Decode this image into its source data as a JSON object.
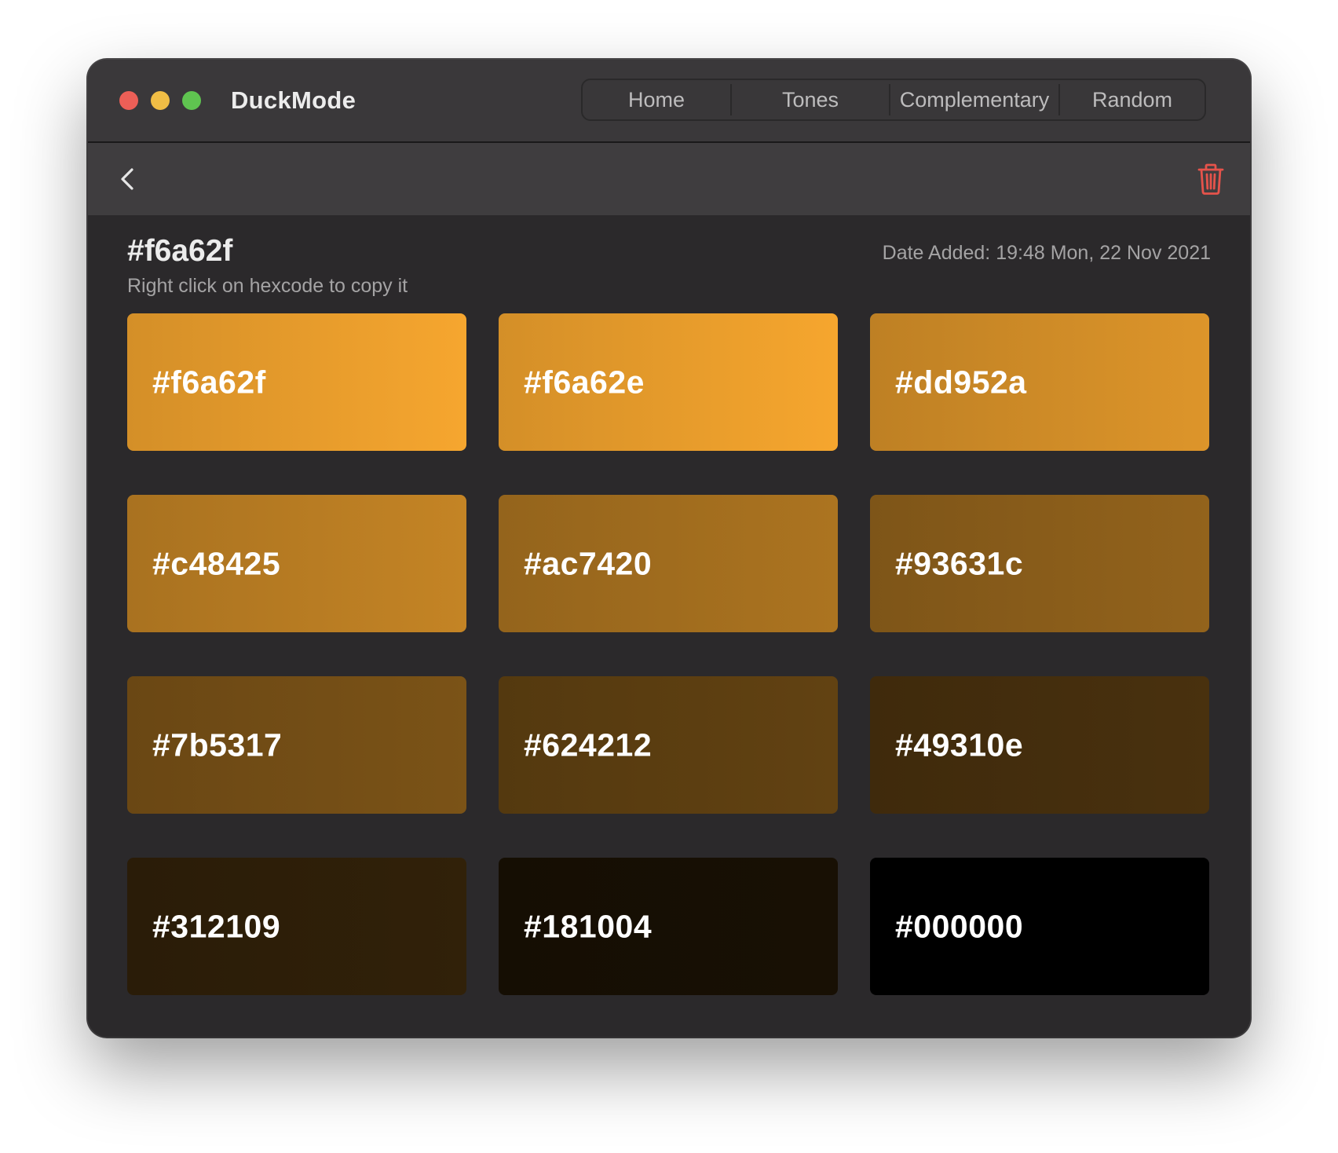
{
  "app": {
    "title": "DuckMode"
  },
  "nav": {
    "tabs": [
      {
        "label": "Home"
      },
      {
        "label": "Tones"
      },
      {
        "label": "Complementary"
      },
      {
        "label": "Random"
      }
    ]
  },
  "toolbar": {
    "back_icon": "chevron-left-icon",
    "delete_icon": "trash-icon",
    "delete_color": "#e5534b"
  },
  "palette": {
    "hex": "#f6a62f",
    "hint": "Right click on hexcode to copy it",
    "date_added": "Date Added: 19:48 Mon, 22 Nov 2021",
    "swatches": [
      {
        "label": "#f6a62f",
        "color": "#f6a62f"
      },
      {
        "label": "#f6a62e",
        "color": "#f6a62e"
      },
      {
        "label": "#dd952a",
        "color": "#dd952a"
      },
      {
        "label": "#c48425",
        "color": "#c48425"
      },
      {
        "label": "#ac7420",
        "color": "#ac7420"
      },
      {
        "label": "#93631c",
        "color": "#93631c"
      },
      {
        "label": "#7b5317",
        "color": "#7b5317"
      },
      {
        "label": "#624212",
        "color": "#624212"
      },
      {
        "label": "#49310e",
        "color": "#49310e"
      },
      {
        "label": "#312109",
        "color": "#312109"
      },
      {
        "label": "#181004",
        "color": "#181004"
      },
      {
        "label": "#000000",
        "color": "#000000"
      }
    ]
  },
  "window_controls": {
    "close_color": "#ec5f57",
    "minimize_color": "#f0bd45",
    "zoom_color": "#5fc450"
  }
}
